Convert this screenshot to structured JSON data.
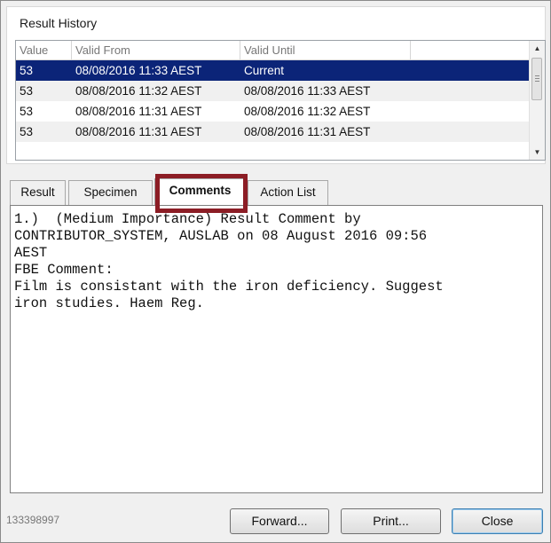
{
  "result_history": {
    "title": "Result History",
    "columns": [
      "Value",
      "Valid From",
      "Valid Until"
    ],
    "rows": [
      {
        "value": "53",
        "valid_from": "08/08/2016 11:33 AEST",
        "valid_until": "Current",
        "selected": true
      },
      {
        "value": "53",
        "valid_from": "08/08/2016 11:32 AEST",
        "valid_until": "08/08/2016 11:33 AEST",
        "selected": false
      },
      {
        "value": "53",
        "valid_from": "08/08/2016 11:31 AEST",
        "valid_until": "08/08/2016 11:32 AEST",
        "selected": false
      },
      {
        "value": "53",
        "valid_from": "08/08/2016 11:31 AEST",
        "valid_until": "08/08/2016 11:31 AEST",
        "selected": false
      }
    ]
  },
  "tabs": [
    {
      "label": "Result",
      "active": false
    },
    {
      "label": "Specimen",
      "active": false
    },
    {
      "label": "Comments",
      "active": true
    },
    {
      "label": "Action List",
      "active": false
    }
  ],
  "comment_lines": [
    "1.)  (Medium Importance) Result Comment by",
    "CONTRIBUTOR_SYSTEM, AUSLAB on 08 August 2016 09:56",
    "AEST",
    "FBE Comment:",
    "Film is consistant with the iron deficiency. Suggest",
    "iron studies. Haem Reg."
  ],
  "footer": {
    "record_id": "133398997",
    "forward_label": "Forward...",
    "print_label": "Print...",
    "close_label": "Close"
  },
  "colors": {
    "selection": "#0b2478",
    "highlight_box": "#8c1d25"
  }
}
